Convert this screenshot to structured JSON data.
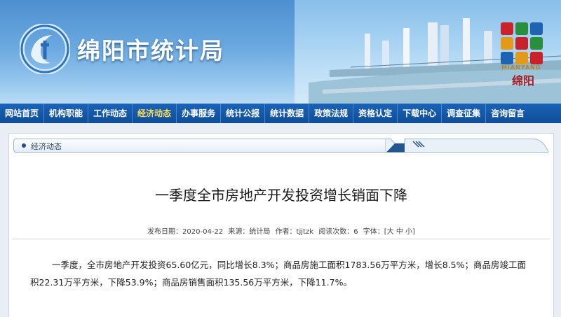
{
  "header": {
    "site_title": "绵阳市统计局",
    "emblem_text": "MIANYANG",
    "emblem_script": "绵阳",
    "colors": {
      "banner_top": "#4d8fd0",
      "nav_bg": "#1a63b8",
      "nav_active": "#ffde5a"
    }
  },
  "nav": {
    "items": [
      {
        "label": "网站首页"
      },
      {
        "label": "机构职能"
      },
      {
        "label": "工作动态"
      },
      {
        "label": "经济动态"
      },
      {
        "label": "办事服务"
      },
      {
        "label": "统计公报"
      },
      {
        "label": "统计数据"
      },
      {
        "label": "政策法规"
      },
      {
        "label": "资格认定"
      },
      {
        "label": "下载中心"
      },
      {
        "label": "调查征集"
      },
      {
        "label": "咨询留言"
      }
    ],
    "active": "经济动态"
  },
  "breadcrumb": {
    "label": "经济动态"
  },
  "article": {
    "title": "一季度全市房地产开发投资增长销面下降",
    "meta": {
      "date": "发布日期：2020-04-22",
      "source": "来源：统计局",
      "author": "作者：tjjtzk",
      "views": "阅读次数：6",
      "font_size": "字体：[大 中 小]"
    },
    "body": "一季度，全市房地产开发投资65.60亿元，同比增长8.3%；商品房施工面积1783.56万平方米，增长8.5%；商品房竣工面积22.31万平方米，下降53.9%；商品房销售面积135.56万平方米，下降11.7%。"
  }
}
